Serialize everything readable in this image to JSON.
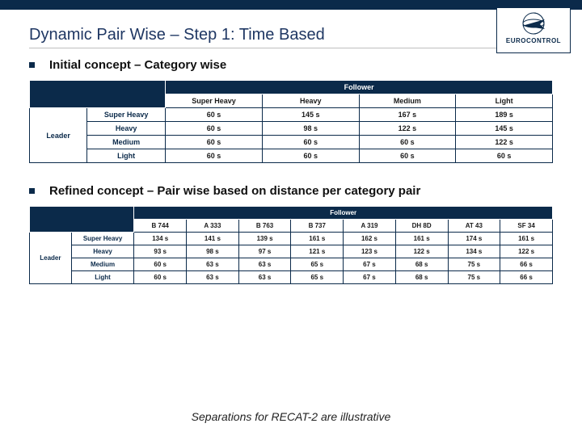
{
  "title": "Dynamic Pair Wise – Step 1: Time Based",
  "logo_text": "EUROCONTROL",
  "section1": {
    "heading": "Initial concept – Category wise",
    "follower_label": "Follower",
    "leader_label": "Leader",
    "col_headers": [
      "Super Heavy",
      "Heavy",
      "Medium",
      "Light"
    ],
    "rows": [
      {
        "label": "Super Heavy",
        "cells": [
          "60 s",
          "145 s",
          "167 s",
          "189 s"
        ]
      },
      {
        "label": "Heavy",
        "cells": [
          "60 s",
          "98 s",
          "122 s",
          "145 s"
        ]
      },
      {
        "label": "Medium",
        "cells": [
          "60 s",
          "60 s",
          "60 s",
          "122 s"
        ]
      },
      {
        "label": "Light",
        "cells": [
          "60 s",
          "60 s",
          "60 s",
          "60 s"
        ]
      }
    ]
  },
  "section2": {
    "heading": "Refined concept – Pair wise based on distance per category pair",
    "follower_label": "Follower",
    "leader_label": "Leader",
    "col_headers": [
      "B 744",
      "A 333",
      "B 763",
      "B 737",
      "A 319",
      "DH 8D",
      "AT 43",
      "SF 34"
    ],
    "rows": [
      {
        "label": "Super Heavy",
        "cells": [
          "134 s",
          "141 s",
          "139 s",
          "161 s",
          "162 s",
          "161 s",
          "174 s",
          "161 s"
        ]
      },
      {
        "label": "Heavy",
        "cells": [
          "93 s",
          "98 s",
          "97 s",
          "121 s",
          "123 s",
          "122 s",
          "134 s",
          "122 s"
        ]
      },
      {
        "label": "Medium",
        "cells": [
          "60 s",
          "63 s",
          "63 s",
          "65 s",
          "67 s",
          "68 s",
          "75 s",
          "66 s"
        ]
      },
      {
        "label": "Light",
        "cells": [
          "60 s",
          "63 s",
          "63 s",
          "65 s",
          "67 s",
          "68 s",
          "75 s",
          "66 s"
        ]
      }
    ]
  },
  "footnote": "Separations for RECAT-2 are illustrative"
}
